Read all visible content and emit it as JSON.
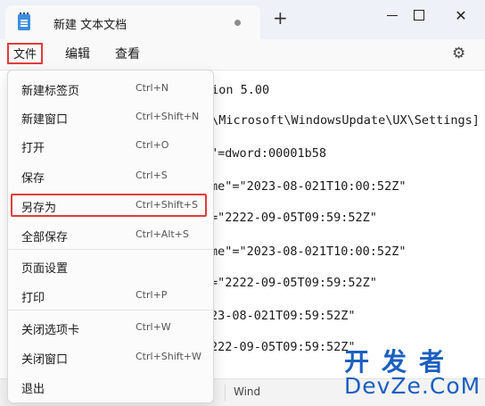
{
  "window": {
    "tab_title": "新建 文本文档",
    "new_tab": "+",
    "close_symbol": "✕"
  },
  "menubar": {
    "file": "文件",
    "edit": "编辑",
    "view": "查看"
  },
  "editor": {
    "lines": [
      "sion 5.00",
      "E\\Microsoft\\WindowsUpdate\\UX\\Settings]",
      "\"=dword:00001b58",
      "me\"=\"2023-08-021T10:00:52Z\"",
      "=\"2222-09-05T09:59:52Z\"",
      "me\"=\"2023-08-021T10:00:52Z\"",
      "=\"2222-09-05T09:59:52Z\"",
      "23-08-021T09:59:52Z\"",
      "222-09-05T09:59:52Z\""
    ]
  },
  "file_menu": {
    "items": [
      {
        "label": "新建标签页",
        "shortcut": "Ctrl+N"
      },
      {
        "label": "新建窗口",
        "shortcut": "Ctrl+Shift+N"
      },
      {
        "label": "打开",
        "shortcut": "Ctrl+O"
      },
      {
        "label": "保存",
        "shortcut": "Ctrl+S"
      },
      {
        "label": "另存为",
        "shortcut": "Ctrl+Shift+S"
      },
      {
        "label": "全部保存",
        "shortcut": "Ctrl+Alt+S"
      },
      {
        "label": "页面设置",
        "shortcut": ""
      },
      {
        "label": "打印",
        "shortcut": "Ctrl+P"
      },
      {
        "label": "关闭选项卡",
        "shortcut": "Ctrl+W"
      },
      {
        "label": "关闭窗口",
        "shortcut": "Ctrl+Shift+W"
      },
      {
        "label": "退出",
        "shortcut": ""
      }
    ]
  },
  "statusbar": {
    "encoding_partial": "Wind"
  },
  "watermark": {
    "top": "开发者",
    "bottom": "DevZe.CoM"
  },
  "colors": {
    "highlight": "#e23c3c",
    "watermark": "#1b5fc1"
  }
}
